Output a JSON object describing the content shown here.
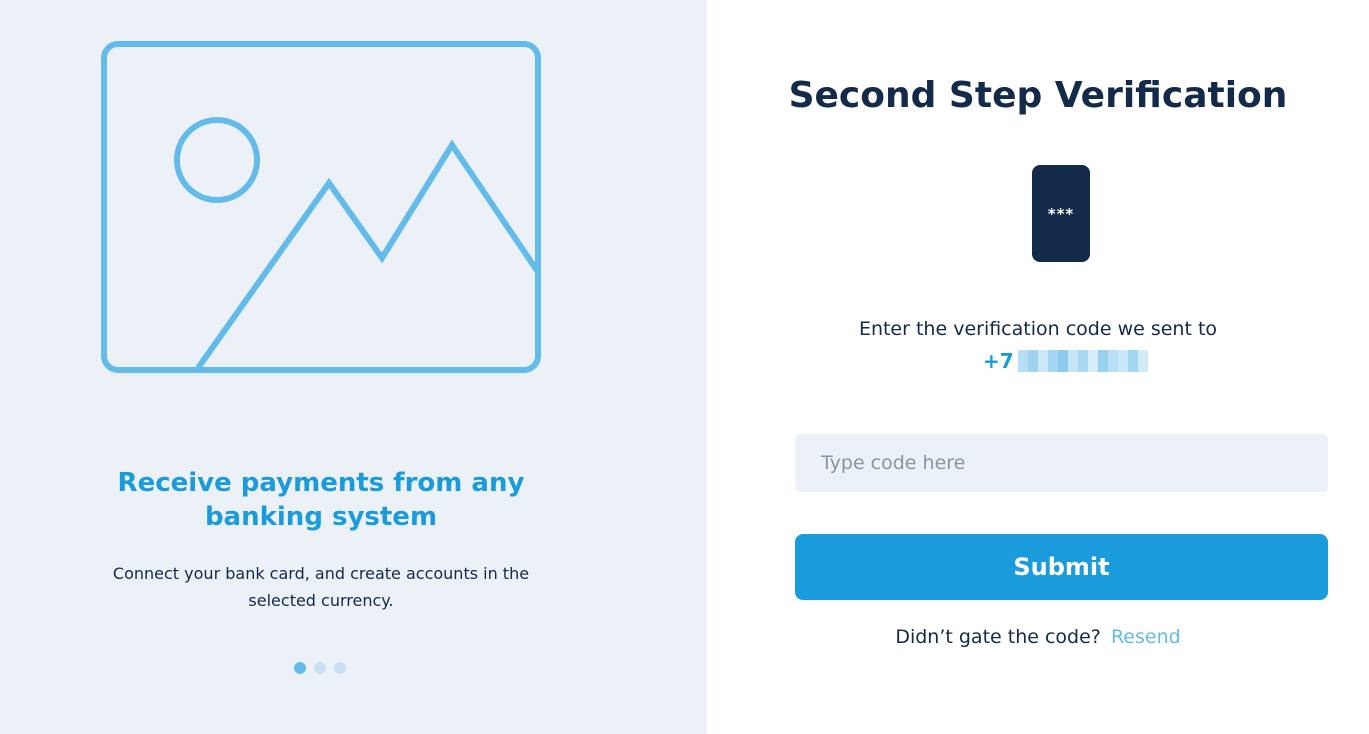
{
  "promo": {
    "title": "Receive payments from any banking system",
    "text": "Connect your bank card, and create accounts in the selected currency.",
    "slides": 3,
    "active_slide": 1,
    "illustration_icon": "image-placeholder-icon"
  },
  "verification": {
    "title": "Second Step Verification",
    "phone_icon_text": "***",
    "sent_text": "Enter the verification code we sent to",
    "phone_prefix": "+7",
    "code_placeholder": "Type code here",
    "submit_label": "Submit",
    "resend_prompt": "Didn’t gate the code?",
    "resend_label": "Resend"
  },
  "colors": {
    "accent": "#1a9bdb",
    "accent_light": "#62bbe8",
    "dark": "#132a4a",
    "panel_bg": "#ecf1f8"
  }
}
